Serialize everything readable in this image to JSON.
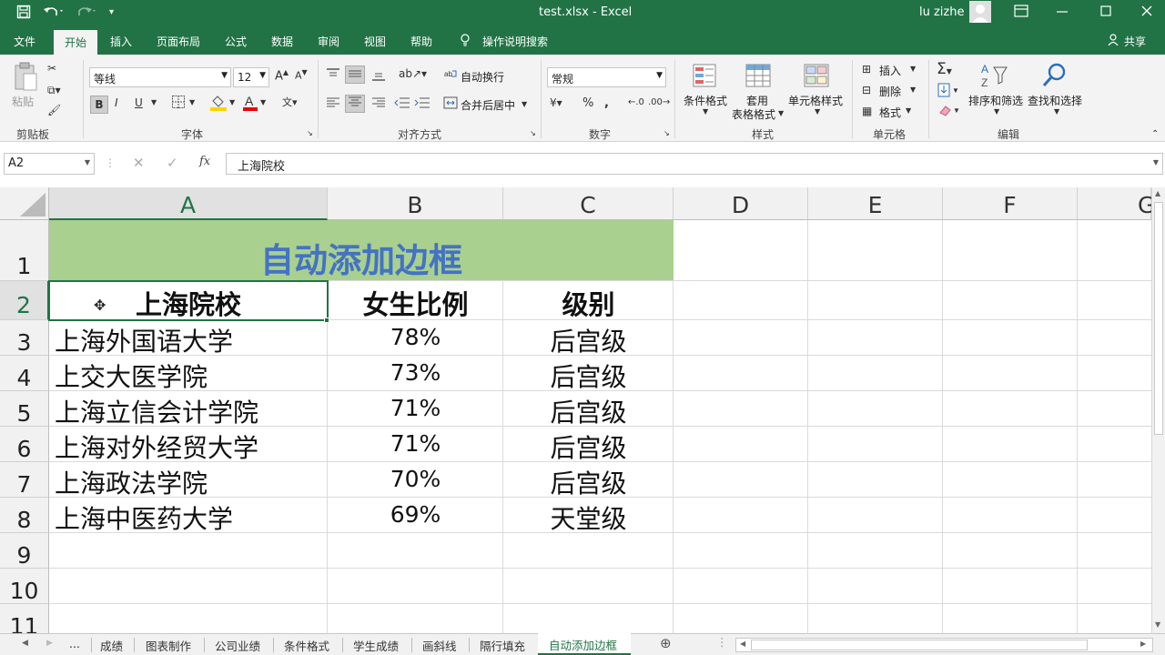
{
  "title_bar": {
    "doc_title": "test.xlsx  -  Excel",
    "user": "lu zizhe",
    "icons": [
      "save-icon",
      "undo-icon",
      "redo-icon",
      "customize-icon",
      "ribbon-display-icon",
      "minimize-icon",
      "maximize-icon",
      "close-icon"
    ]
  },
  "ribbon_tabs": {
    "file": "文件",
    "home": "开始",
    "insert": "插入",
    "layout": "页面布局",
    "formulas": "公式",
    "data": "数据",
    "review": "审阅",
    "view": "视图",
    "help": "帮助",
    "tell_me": "操作说明搜索",
    "share": "共享"
  },
  "ribbon": {
    "clipboard": {
      "paste": "粘贴",
      "label": "剪贴板"
    },
    "font": {
      "name": "等线",
      "size": "12",
      "bold": "B",
      "italic": "I",
      "underline": "U",
      "label": "字体"
    },
    "alignment": {
      "wrap": "自动换行",
      "merge": "合并后居中",
      "label": "对齐方式"
    },
    "number": {
      "format": "常规",
      "label": "数字"
    },
    "styles": {
      "conditional": "条件格式",
      "table": "套用",
      "table2": "表格格式",
      "cell_styles": "单元格样式",
      "label": "样式"
    },
    "cells": {
      "insert": "插入",
      "delete": "删除",
      "format": "格式",
      "label": "单元格"
    },
    "editing": {
      "sort": "排序和筛选",
      "find": "查找和选择",
      "label": "编辑"
    }
  },
  "formula_bar": {
    "name_box": "A2",
    "content": "上海院校",
    "fx": "fx"
  },
  "grid": {
    "columns": [
      "A",
      "B",
      "C",
      "D",
      "E",
      "F",
      "G"
    ],
    "rows": [
      "1",
      "2",
      "3",
      "4",
      "5",
      "6",
      "7",
      "8",
      "9",
      "10",
      "11"
    ],
    "title": "自动添加边框",
    "header": [
      "上海院校",
      "女生比例",
      "级别"
    ],
    "data": [
      [
        "上海外国语大学",
        "78%",
        "后宫级"
      ],
      [
        "上交大医学院",
        "73%",
        "后宫级"
      ],
      [
        "上海立信会计学院",
        "71%",
        "后宫级"
      ],
      [
        "上海对外经贸大学",
        "71%",
        "后宫级"
      ],
      [
        "上海政法学院",
        "70%",
        "后宫级"
      ],
      [
        "上海中医药大学",
        "69%",
        "天堂级"
      ]
    ],
    "title_fill": "#a9d08e",
    "title_color": "#4472c4"
  },
  "sheet_tabs": {
    "ellipsis": "...",
    "tabs": [
      "成绩",
      "图表制作",
      "公司业绩",
      "条件格式",
      "学生成绩",
      "画斜线",
      "隔行填充",
      "自动添加边框"
    ],
    "active": "自动添加边框"
  }
}
